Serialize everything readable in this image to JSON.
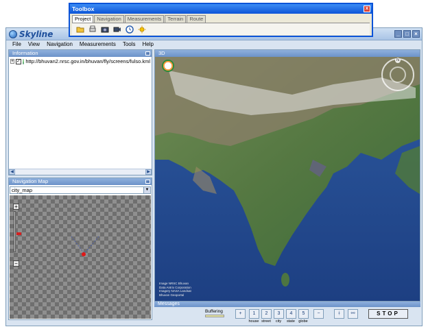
{
  "app": {
    "logo_text": "Skyline"
  },
  "menu": [
    "File",
    "View",
    "Navigation",
    "Measurements",
    "Tools",
    "Help"
  ],
  "information_panel": {
    "title": "Information",
    "tree_item": "http://bhuvan2.nrsc.gov.in/bhuvan/fly/screens/fulso.kml"
  },
  "navigation_map": {
    "title": "Navigation Map",
    "selected_map": "city_map"
  },
  "view3d": {
    "title": "3D",
    "credits": [
      "Image NRSC Bhuvan",
      "Data Antrix Corporation",
      "Imagery NASA Landsat",
      "Bhuvan Geoportal"
    ]
  },
  "messages": {
    "title": "Messages"
  },
  "bottom_toolbar": {
    "buffer_label": "Buffering",
    "levels": [
      {
        "num": "1",
        "label": "house"
      },
      {
        "num": "2",
        "label": "street"
      },
      {
        "num": "3",
        "label": "city"
      },
      {
        "num": "4",
        "label": "state"
      },
      {
        "num": "5",
        "label": "globe"
      }
    ],
    "stop_label": "STOP"
  },
  "toolbox": {
    "title": "Toolbox",
    "tabs": [
      "Project",
      "Navigation",
      "Measurements",
      "Terrain",
      "Route"
    ],
    "active_tab": "Project",
    "close_label": "x"
  },
  "colors": {
    "panel_header": "#7aa0d4",
    "window_bg": "#d9e4f1",
    "toolbox_title": "#0d55d8"
  }
}
